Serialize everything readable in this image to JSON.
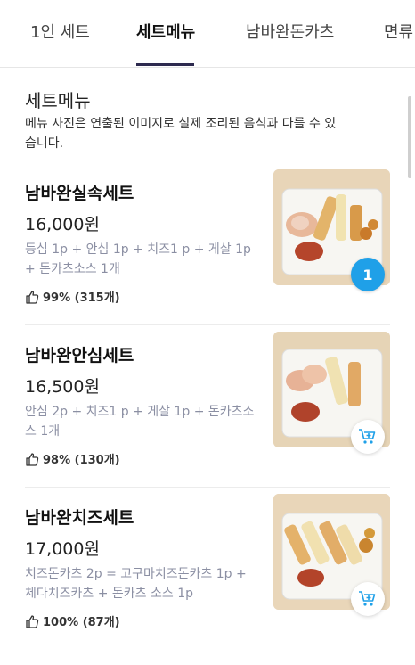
{
  "tabs": [
    {
      "label": "1인 세트"
    },
    {
      "label": "세트메뉴"
    },
    {
      "label": "남바완돈카츠"
    },
    {
      "label": "면류"
    }
  ],
  "section": {
    "title": "세트메뉴",
    "description": "메뉴 사진은 연출된 이미지로 실제 조리된 음식과 다를 수 있습니다."
  },
  "items": [
    {
      "name": "남바완실속세트",
      "price": "16,000원",
      "description": "등심 1p + 안심 1p + 치즈1 p + 게살 1p + 돈카츠소스 1개",
      "rating": "99% (315개)",
      "cart_count": "1"
    },
    {
      "name": "남바완안심세트",
      "price": "16,500원",
      "description": "안심 2p + 치즈1 p + 게살 1p + 돈카츠소스 1개",
      "rating": "98% (130개)"
    },
    {
      "name": "남바완치즈세트",
      "price": "17,000원",
      "description": "치즈돈카츠 2p = 고구마치즈돈카츠 1p + 체다치즈카츠 + 돈카츠 소스 1p",
      "rating": "100% (87개)"
    }
  ],
  "colors": {
    "accent": "#1fa0e8",
    "tab_underline": "#2d2a4f",
    "desc_gray": "#8b8fa3"
  }
}
